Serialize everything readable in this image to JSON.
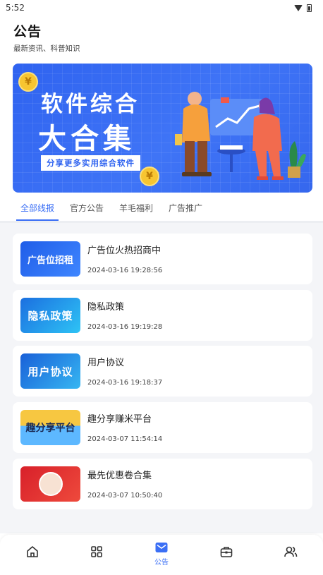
{
  "status_bar": {
    "time": "5:52"
  },
  "header": {
    "title": "公告",
    "subtitle": "最新资讯、科普知识"
  },
  "banner": {
    "line1": "软件综合",
    "line2": "大合集",
    "tag": "分享更多实用综合软件",
    "coin_symbol": "¥"
  },
  "tabs": [
    {
      "label": "全部线报",
      "active": true
    },
    {
      "label": "官方公告",
      "active": false
    },
    {
      "label": "羊毛福利",
      "active": false
    },
    {
      "label": "广告推广",
      "active": false
    }
  ],
  "items": [
    {
      "title": "广告位火热招商中",
      "time": "2024-03-16 19:28:56",
      "thumb_text": "广告位招租"
    },
    {
      "title": "隐私政策",
      "time": "2024-03-16 19:19:28",
      "thumb_text": "隐私政策"
    },
    {
      "title": "用户协议",
      "time": "2024-03-16 19:18:37",
      "thumb_text": "用户协议"
    },
    {
      "title": "趣分享赚米平台",
      "time": "2024-03-07 11:54:14",
      "thumb_text": "趣分享平台"
    },
    {
      "title": "最先优惠卷合集",
      "time": "2024-03-07 10:50:40",
      "thumb_text": ""
    }
  ],
  "bottom_nav": [
    {
      "icon": "home-icon",
      "label": ""
    },
    {
      "icon": "grid-icon",
      "label": ""
    },
    {
      "icon": "mail-icon",
      "label": "公告",
      "active": true
    },
    {
      "icon": "toolbox-icon",
      "label": ""
    },
    {
      "icon": "users-icon",
      "label": ""
    }
  ],
  "colors": {
    "accent": "#3b6ff5",
    "banner_blue": "#2f63f0",
    "list_bg": "#f4f5f8"
  }
}
